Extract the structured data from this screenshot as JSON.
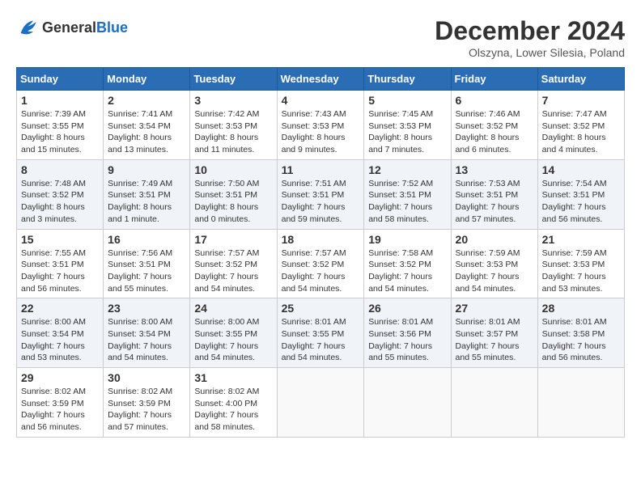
{
  "logo": {
    "line1": "General",
    "line2": "Blue"
  },
  "title": "December 2024",
  "subtitle": "Olszyna, Lower Silesia, Poland",
  "weekdays": [
    "Sunday",
    "Monday",
    "Tuesday",
    "Wednesday",
    "Thursday",
    "Friday",
    "Saturday"
  ],
  "weeks": [
    [
      {
        "day": "1",
        "info": "Sunrise: 7:39 AM\nSunset: 3:55 PM\nDaylight: 8 hours and 15 minutes."
      },
      {
        "day": "2",
        "info": "Sunrise: 7:41 AM\nSunset: 3:54 PM\nDaylight: 8 hours and 13 minutes."
      },
      {
        "day": "3",
        "info": "Sunrise: 7:42 AM\nSunset: 3:53 PM\nDaylight: 8 hours and 11 minutes."
      },
      {
        "day": "4",
        "info": "Sunrise: 7:43 AM\nSunset: 3:53 PM\nDaylight: 8 hours and 9 minutes."
      },
      {
        "day": "5",
        "info": "Sunrise: 7:45 AM\nSunset: 3:53 PM\nDaylight: 8 hours and 7 minutes."
      },
      {
        "day": "6",
        "info": "Sunrise: 7:46 AM\nSunset: 3:52 PM\nDaylight: 8 hours and 6 minutes."
      },
      {
        "day": "7",
        "info": "Sunrise: 7:47 AM\nSunset: 3:52 PM\nDaylight: 8 hours and 4 minutes."
      }
    ],
    [
      {
        "day": "8",
        "info": "Sunrise: 7:48 AM\nSunset: 3:52 PM\nDaylight: 8 hours and 3 minutes."
      },
      {
        "day": "9",
        "info": "Sunrise: 7:49 AM\nSunset: 3:51 PM\nDaylight: 8 hours and 1 minute."
      },
      {
        "day": "10",
        "info": "Sunrise: 7:50 AM\nSunset: 3:51 PM\nDaylight: 8 hours and 0 minutes."
      },
      {
        "day": "11",
        "info": "Sunrise: 7:51 AM\nSunset: 3:51 PM\nDaylight: 7 hours and 59 minutes."
      },
      {
        "day": "12",
        "info": "Sunrise: 7:52 AM\nSunset: 3:51 PM\nDaylight: 7 hours and 58 minutes."
      },
      {
        "day": "13",
        "info": "Sunrise: 7:53 AM\nSunset: 3:51 PM\nDaylight: 7 hours and 57 minutes."
      },
      {
        "day": "14",
        "info": "Sunrise: 7:54 AM\nSunset: 3:51 PM\nDaylight: 7 hours and 56 minutes."
      }
    ],
    [
      {
        "day": "15",
        "info": "Sunrise: 7:55 AM\nSunset: 3:51 PM\nDaylight: 7 hours and 56 minutes."
      },
      {
        "day": "16",
        "info": "Sunrise: 7:56 AM\nSunset: 3:51 PM\nDaylight: 7 hours and 55 minutes."
      },
      {
        "day": "17",
        "info": "Sunrise: 7:57 AM\nSunset: 3:52 PM\nDaylight: 7 hours and 54 minutes."
      },
      {
        "day": "18",
        "info": "Sunrise: 7:57 AM\nSunset: 3:52 PM\nDaylight: 7 hours and 54 minutes."
      },
      {
        "day": "19",
        "info": "Sunrise: 7:58 AM\nSunset: 3:52 PM\nDaylight: 7 hours and 54 minutes."
      },
      {
        "day": "20",
        "info": "Sunrise: 7:59 AM\nSunset: 3:53 PM\nDaylight: 7 hours and 54 minutes."
      },
      {
        "day": "21",
        "info": "Sunrise: 7:59 AM\nSunset: 3:53 PM\nDaylight: 7 hours and 53 minutes."
      }
    ],
    [
      {
        "day": "22",
        "info": "Sunrise: 8:00 AM\nSunset: 3:54 PM\nDaylight: 7 hours and 53 minutes."
      },
      {
        "day": "23",
        "info": "Sunrise: 8:00 AM\nSunset: 3:54 PM\nDaylight: 7 hours and 54 minutes."
      },
      {
        "day": "24",
        "info": "Sunrise: 8:00 AM\nSunset: 3:55 PM\nDaylight: 7 hours and 54 minutes."
      },
      {
        "day": "25",
        "info": "Sunrise: 8:01 AM\nSunset: 3:55 PM\nDaylight: 7 hours and 54 minutes."
      },
      {
        "day": "26",
        "info": "Sunrise: 8:01 AM\nSunset: 3:56 PM\nDaylight: 7 hours and 55 minutes."
      },
      {
        "day": "27",
        "info": "Sunrise: 8:01 AM\nSunset: 3:57 PM\nDaylight: 7 hours and 55 minutes."
      },
      {
        "day": "28",
        "info": "Sunrise: 8:01 AM\nSunset: 3:58 PM\nDaylight: 7 hours and 56 minutes."
      }
    ],
    [
      {
        "day": "29",
        "info": "Sunrise: 8:02 AM\nSunset: 3:59 PM\nDaylight: 7 hours and 56 minutes."
      },
      {
        "day": "30",
        "info": "Sunrise: 8:02 AM\nSunset: 3:59 PM\nDaylight: 7 hours and 57 minutes."
      },
      {
        "day": "31",
        "info": "Sunrise: 8:02 AM\nSunset: 4:00 PM\nDaylight: 7 hours and 58 minutes."
      },
      null,
      null,
      null,
      null
    ]
  ]
}
